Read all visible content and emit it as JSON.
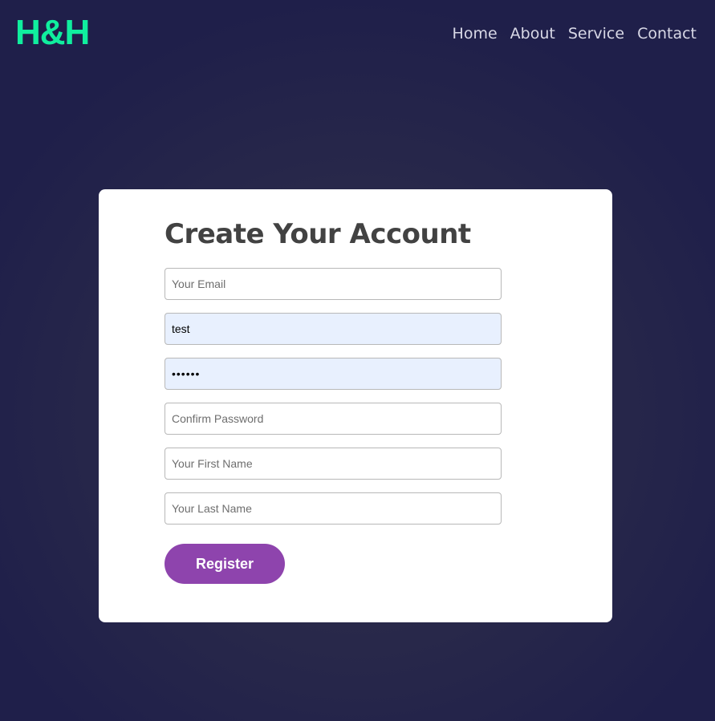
{
  "header": {
    "logo": "H&H",
    "nav": [
      "Home",
      "About",
      "Service",
      "Contact"
    ]
  },
  "form": {
    "title": "Create Your Account",
    "fields": [
      {
        "placeholder": "Your Email",
        "value": ""
      },
      {
        "placeholder": "",
        "value": "test"
      },
      {
        "placeholder": "",
        "value": "••••••"
      },
      {
        "placeholder": "Confirm Password",
        "value": ""
      },
      {
        "placeholder": "Your First Name",
        "value": ""
      },
      {
        "placeholder": "Your Last Name",
        "value": ""
      }
    ],
    "submit_label": "Register"
  },
  "colors": {
    "background": "#1f1f4a",
    "logo": "#10ee9e",
    "button": "#8e44ad",
    "autofill": "#e8f0fe"
  }
}
